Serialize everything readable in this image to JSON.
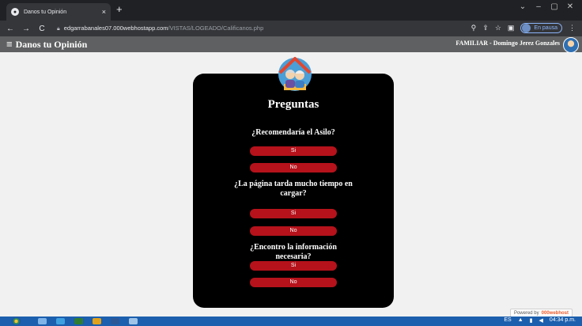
{
  "browser": {
    "tab_title": "Danos tu Opinión",
    "tab_close": "×",
    "new_tab": "+",
    "url_host": "edgarrabanales07.000webhostapp.com",
    "url_path": "/VISTAS/LOGEADO/Calificanos.php",
    "profile_status": "En pausa",
    "window_controls": [
      "⌄",
      "–",
      "▢",
      "✕"
    ]
  },
  "app": {
    "title": "Danos tu Opinión",
    "user_label": "FAMILIAR - Domingo Jerez Gonzales"
  },
  "form": {
    "heading": "Preguntas",
    "questions": [
      {
        "text": "¿Recomendaría el Asilo?",
        "yes": "Si",
        "no": "No"
      },
      {
        "text": "¿La página tarda mucho tiempo en cargar?",
        "yes": "Si",
        "no": "No"
      },
      {
        "text": "¿Encontro la información necesaria?",
        "yes": "Si",
        "no": "No"
      }
    ]
  },
  "footer": {
    "powered_by": "Powered by",
    "powered_brand": "000webhost"
  },
  "taskbar": {
    "time": "04:34 p.m."
  },
  "colors": {
    "button_red": "#b5121b",
    "card_bg": "#000000",
    "header_bg": "#5f6061"
  },
  "icons": {
    "menu": "hamburger-icon",
    "logo": "elderly-couple-house-logo"
  }
}
